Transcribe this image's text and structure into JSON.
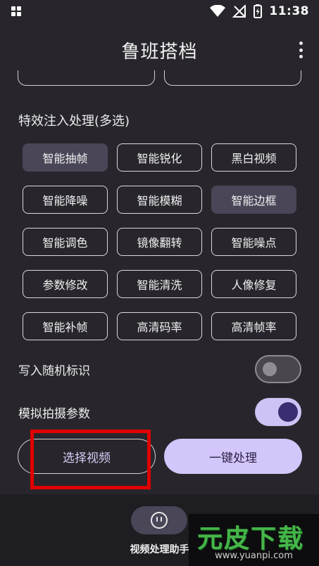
{
  "statusbar": {
    "time": "11:38"
  },
  "header": {
    "title": "鲁班搭档"
  },
  "effects": {
    "label": "特效注入处理(多选)",
    "chips": [
      {
        "label": "智能抽帧",
        "selected": true
      },
      {
        "label": "智能锐化",
        "selected": false
      },
      {
        "label": "黑白视频",
        "selected": false
      },
      {
        "label": "智能降噪",
        "selected": false
      },
      {
        "label": "智能模糊",
        "selected": false
      },
      {
        "label": "智能边框",
        "selected": true
      },
      {
        "label": "智能调色",
        "selected": false
      },
      {
        "label": "镜像翻转",
        "selected": false
      },
      {
        "label": "智能噪点",
        "selected": false
      },
      {
        "label": "参数修改",
        "selected": false
      },
      {
        "label": "智能清洗",
        "selected": false
      },
      {
        "label": "人像修复",
        "selected": false
      },
      {
        "label": "智能补帧",
        "selected": false
      },
      {
        "label": "高清码率",
        "selected": false
      },
      {
        "label": "高清帧率",
        "selected": false
      }
    ]
  },
  "toggles": {
    "random_mark": {
      "label": "写入随机标识",
      "on": false
    },
    "simulate_params": {
      "label": "模拟拍摄参数",
      "on": true
    }
  },
  "actions": {
    "select_video": "选择视频",
    "one_click_process": "一键处理"
  },
  "bottom_nav": {
    "item_label": "视频处理助手",
    "icon": "smiley-face-icon"
  },
  "watermark": {
    "logo": "元皮下载",
    "url": "www.yuanpi.com"
  },
  "colors": {
    "background": "#28262c",
    "accent": "#d3c6fb",
    "selected_chip": "#4a4658",
    "highlight": "#e00000"
  }
}
